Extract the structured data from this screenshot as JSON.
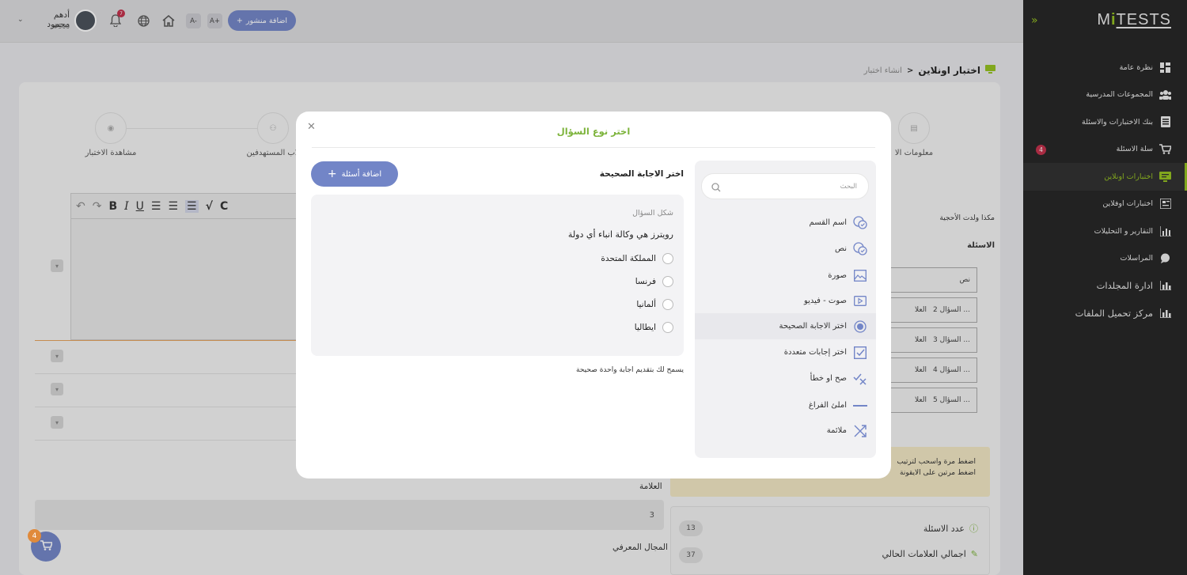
{
  "sidebar": {
    "logo_main": "M",
    "logo_i": "i",
    "logo_rest": "TESTS",
    "items": [
      {
        "label": "نظرة عامة",
        "icon": "dashboard-icon"
      },
      {
        "label": "المجموعات المدرسية",
        "icon": "users-icon"
      },
      {
        "label": "بنك الاختبارات والاسئلة",
        "icon": "book-icon"
      },
      {
        "label": "سلة الاسئلة",
        "icon": "cart-icon",
        "badge": "4"
      },
      {
        "label": "اختبارات اونلاين",
        "icon": "monitor-icon",
        "active": true
      },
      {
        "label": "اختبارات اوفلاين",
        "icon": "newspaper-icon"
      },
      {
        "label": "التقارير و التحليلات",
        "icon": "chart-icon"
      },
      {
        "label": "المراسلات",
        "icon": "chat-icon"
      },
      {
        "label": "ادارة المجلدات",
        "icon": "bar-chart-icon"
      },
      {
        "label": "مركز تحميل الملفات",
        "icon": "bar-chart-icon"
      }
    ]
  },
  "topbar": {
    "add_post": "اضافة منشور",
    "font_minus": "A-",
    "font_plus": "A+",
    "notif_count": "7",
    "user_name": "أدهم محمود",
    "user_id": "#500"
  },
  "page": {
    "breadcrumb_current": "اختبار اونلاين",
    "breadcrumb_sep": ">",
    "breadcrumb_page": "انشاء اختبار",
    "step_view": "مشاهدة الاختبار",
    "step_students": "لاب المستهدفين",
    "step_info": "معلومات الا",
    "title_hint": "مكذا ولدت الأحجية",
    "questions_label": "الاسئلة",
    "q_rows": [
      {
        "label": "نص"
      },
      {
        "label": "السؤال 2 ...",
        "mark": "العلا"
      },
      {
        "label": "السؤال 3 ...",
        "mark": "العلا"
      },
      {
        "label": "السؤال 4 ...",
        "mark": "العلا"
      },
      {
        "label": "السؤال 5 ...",
        "mark": "العلا"
      }
    ],
    "notice_1": "اضغط مرة واسحب لترتيب",
    "notice_2": "اضغط مرتين على الايقونة",
    "mark_label": "العلامة",
    "mark_value": "3",
    "domain_label": "المجال المعرفي",
    "stats": [
      {
        "label": "عدد الاسئلة",
        "value": "13"
      },
      {
        "label": "اجمالي العلامات الحالي",
        "value": "37"
      }
    ],
    "cart_badge": "4"
  },
  "modal": {
    "title": "اختر نوع السؤال",
    "search_placeholder": "البحث",
    "types": [
      {
        "label": "اسم القسم",
        "icon": "section-icon"
      },
      {
        "label": "نص",
        "icon": "text-icon"
      },
      {
        "label": "صورة",
        "icon": "image-icon"
      },
      {
        "label": "صوت - فيديو",
        "icon": "video-icon"
      },
      {
        "label": "اختر الاجابة الصحيحة",
        "icon": "radio-icon",
        "selected": true
      },
      {
        "label": "اختر إجابات متعددة",
        "icon": "checkbox-icon"
      },
      {
        "label": "صح او خطأ",
        "icon": "true-false-icon"
      },
      {
        "label": "املئ الفراغ",
        "icon": "fill-blank-icon"
      },
      {
        "label": "ملائمة",
        "icon": "shuffle-icon"
      }
    ],
    "preview_title": "اختر الاجابة الصحيحة",
    "add_questions": "اضافة أسئلة",
    "shape_label": "شكل السؤال",
    "question_text": "رويترز هي وكالة انباء أي دولة",
    "options": [
      "المملكة المتحدة",
      "فرنسا",
      "ألمانيا",
      "ايطاليا"
    ],
    "hint": "يسمح لك بتقديم اجابة واحدة صحيحة"
  },
  "colors": {
    "accent": "#7285c7",
    "green": "#95c11f",
    "badge": "#c2304b"
  }
}
